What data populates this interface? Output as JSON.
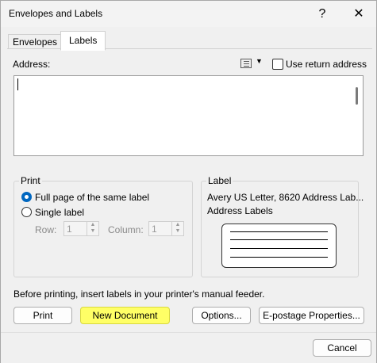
{
  "window": {
    "title": "Envelopes and Labels",
    "help": "?",
    "close": "✕"
  },
  "tabs": [
    {
      "label": "Envelopes"
    },
    {
      "label": "Labels"
    }
  ],
  "address": {
    "label": "Address:",
    "use_return_address": "Use return address",
    "value": ""
  },
  "print_group": {
    "title": "Print",
    "full_page": "Full page of the same label",
    "single_label": "Single label",
    "row_label": "Row:",
    "row_value": "1",
    "column_label": "Column:",
    "column_value": "1"
  },
  "label_group": {
    "title": "Label",
    "line1": "Avery US Letter, 8620 Address Lab...",
    "line2": "Address Labels"
  },
  "notice": "Before printing, insert labels in your printer's manual feeder.",
  "buttons": {
    "print": "Print",
    "new_document": "New Document",
    "options": "Options...",
    "epostage": "E-postage Properties...",
    "cancel": "Cancel"
  },
  "colors": {
    "accent": "#0067c0",
    "highlight": "#ffff66"
  }
}
